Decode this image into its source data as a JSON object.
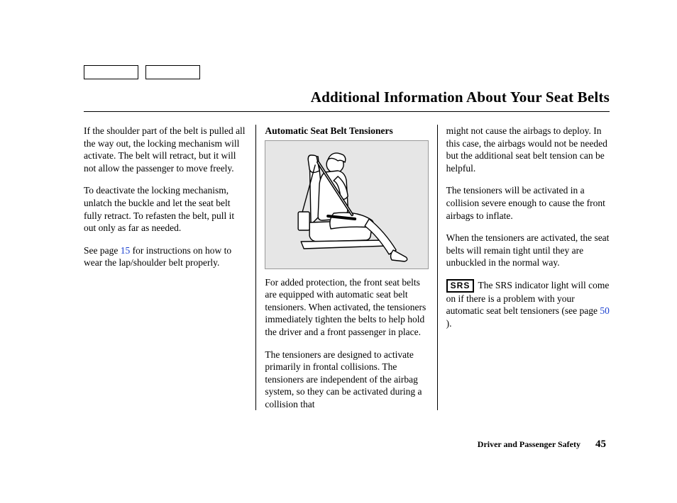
{
  "title": "Additional Information About Your Seat Belts",
  "col1": {
    "p1": "If the shoulder part of the belt is pulled all the way out, the locking mechanism will activate. The belt will retract, but it will not allow the passenger to move freely.",
    "p2": "To deactivate the locking mechanism, unlatch the buckle and let the seat belt fully retract. To refasten the belt, pull it out only as far as needed.",
    "p3a": "See page ",
    "p3link": "15",
    "p3b": " for instructions on how to wear the lap/shoulder belt properly."
  },
  "col2": {
    "subhead": "Automatic Seat Belt Tensioners",
    "p1": "For added protection, the front seat belts are equipped with automatic seat belt tensioners. When activated, the tensioners immediately tighten the belts to help hold the driver and a front passenger in place.",
    "p2": "The tensioners are designed to activate primarily in frontal collisions. The tensioners are independent of the airbag system, so they can be activated during a collision that"
  },
  "col3": {
    "p1": "might not cause the airbags to deploy. In this case, the airbags would not be needed but the additional seat belt tension can be helpful.",
    "p2": "The tensioners will be activated in a collision severe enough to cause the front airbags to inflate.",
    "p3": "When the tensioners are activated, the seat belts will remain tight until they are unbuckled in the normal way.",
    "srs_label": "SRS",
    "p4a": "The SRS indicator light will come on if there is a problem with your automatic seat belt tensioners (see page ",
    "p4link": "50",
    "p4b": " )."
  },
  "footer": {
    "section": "Driver and Passenger Safety",
    "page": "45"
  }
}
